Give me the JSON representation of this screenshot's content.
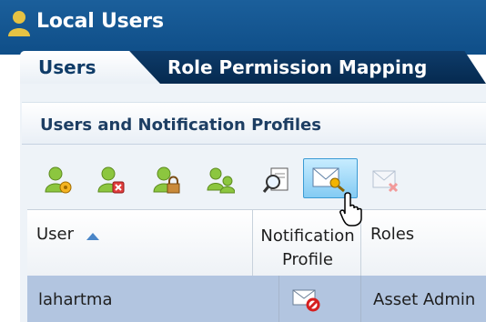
{
  "window": {
    "title": "Local Users"
  },
  "tabs": [
    {
      "label": "Users",
      "active": true
    },
    {
      "label": "Role Permission Mapping",
      "active": false
    }
  ],
  "section": {
    "title": "Users and Notification Profiles"
  },
  "toolbar": {
    "buttons": [
      {
        "icon": "add-user-icon"
      },
      {
        "icon": "delete-user-icon"
      },
      {
        "icon": "lock-user-icon"
      },
      {
        "icon": "users-group-icon"
      },
      {
        "icon": "view-document-icon"
      },
      {
        "icon": "edit-notification-profile-icon",
        "hovered": true
      },
      {
        "icon": "remove-notification-profile-icon",
        "disabled": true
      }
    ]
  },
  "table": {
    "columns": [
      "User",
      "Notification Profile",
      "Roles"
    ],
    "sort": {
      "column": "User",
      "direction": "ascending"
    },
    "rows": [
      {
        "user": "lahartma",
        "notification_icon": "no-notification-profile-icon",
        "roles": "Asset Admin"
      }
    ]
  },
  "colors": {
    "titlebar": "#1b5f9b",
    "active_tab_text": "#0f3c68",
    "selected_row": "#b2c5e0",
    "icon_green": "#7db12f"
  }
}
